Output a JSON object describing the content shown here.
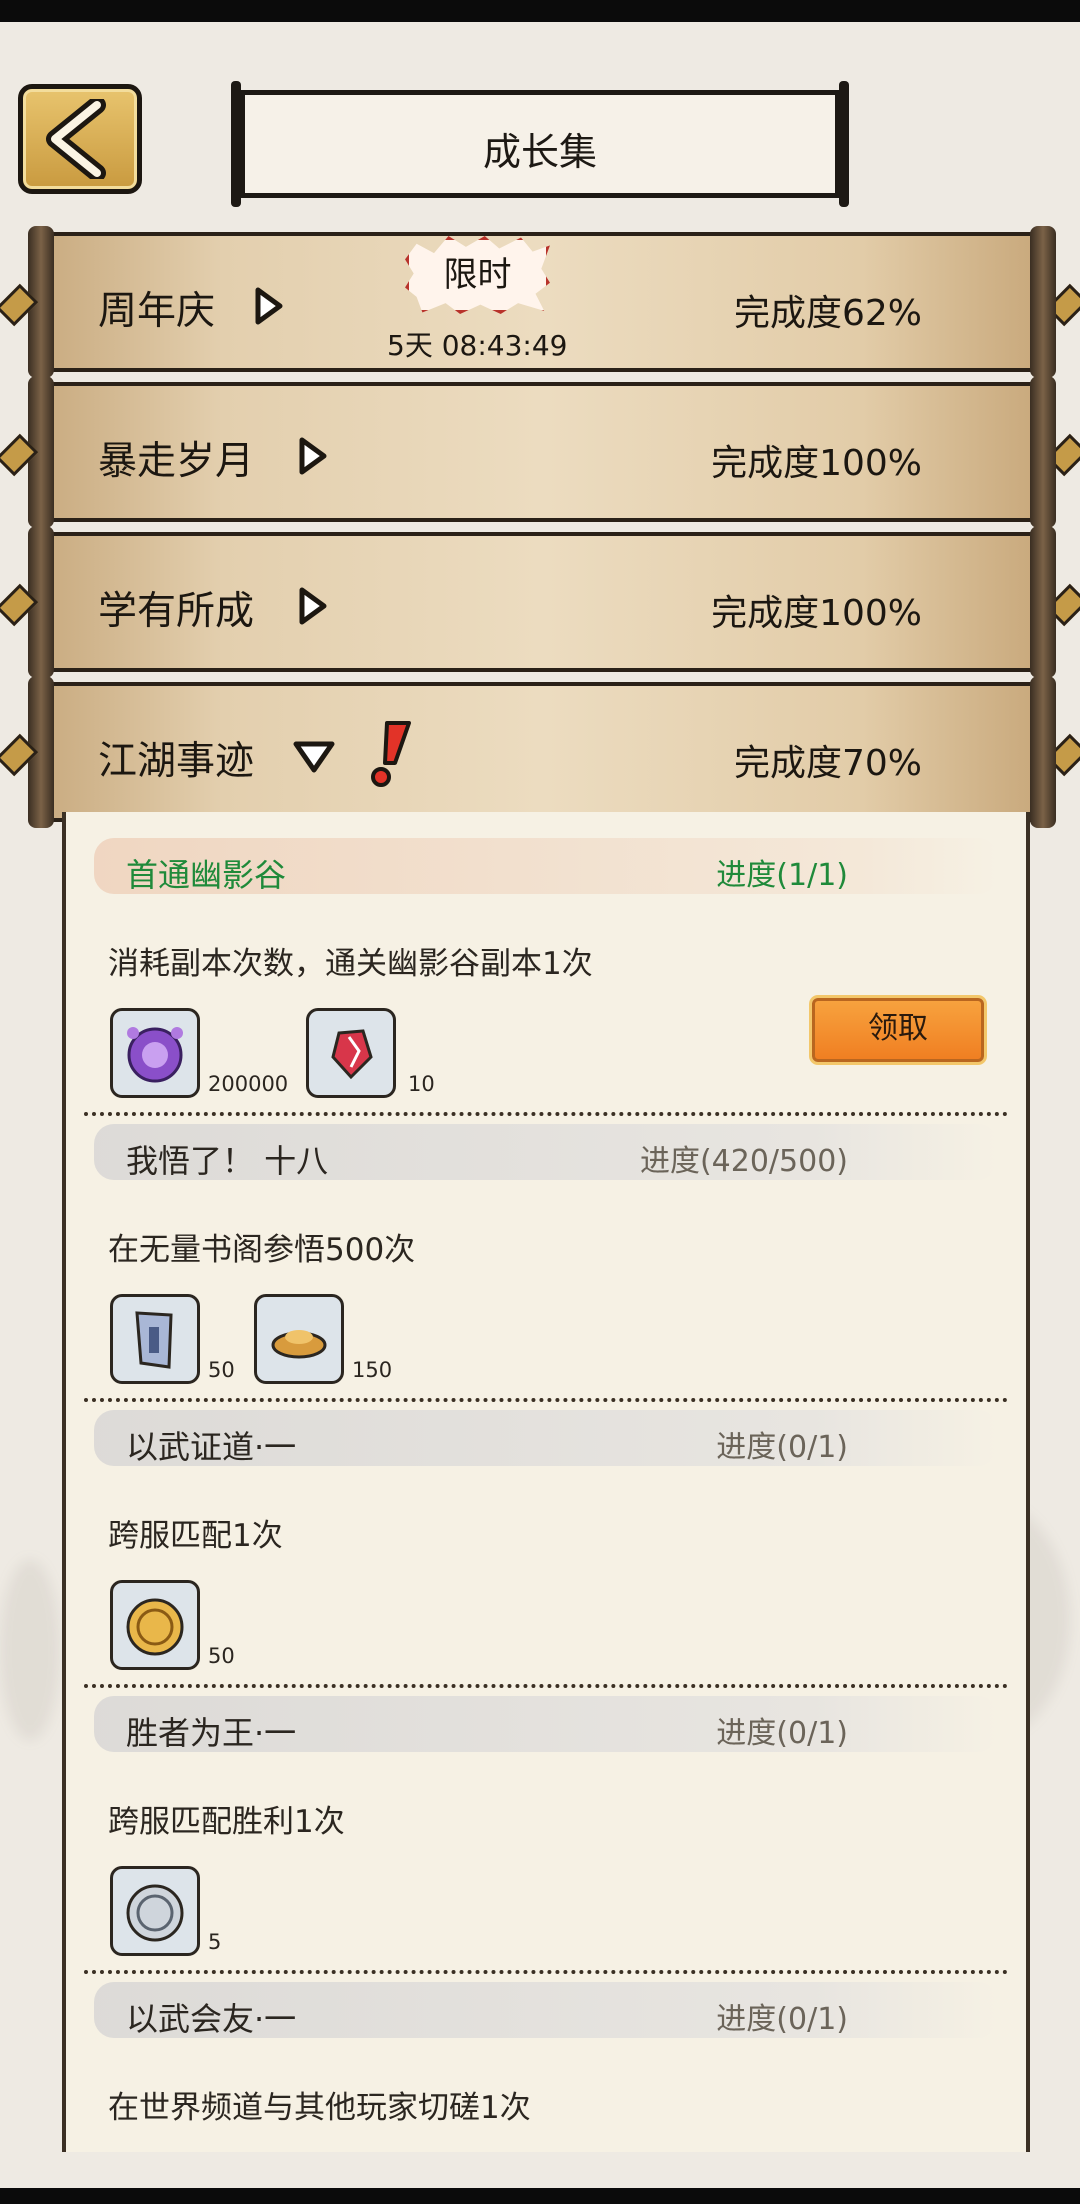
{
  "header": {
    "title": "成长集"
  },
  "categories": [
    {
      "name": "周年庆",
      "progress": "完成度62%",
      "badge": "限时",
      "countdown": "5天 08:43:49"
    },
    {
      "name": "暴走岁月",
      "progress": "完成度100%"
    },
    {
      "name": "学有所成",
      "progress": "完成度100%"
    },
    {
      "name": "江湖事迹",
      "progress": "完成度70%"
    }
  ],
  "tasks": [
    {
      "title": "首通幽影谷",
      "progress": "进度(1/1)",
      "desc": "消耗副本次数，通关幽影谷副本1次",
      "rewards": [
        {
          "icon": "purple-token-icon",
          "count": "200000"
        },
        {
          "icon": "red-crystal-icon",
          "count": "10"
        }
      ],
      "claim_label": "领取"
    },
    {
      "title": "我悟了！ 十八",
      "progress": "进度(420/500)",
      "desc": "在无量书阁参悟500次",
      "rewards": [
        {
          "icon": "scroll-ticket-icon",
          "count": "50"
        },
        {
          "icon": "gold-ingot-icon",
          "count": "150"
        }
      ]
    },
    {
      "title": "以武证道·一",
      "progress": "进度(0/1)",
      "desc": "跨服匹配1次",
      "rewards": [
        {
          "icon": "gold-coin-icon",
          "count": "50"
        }
      ]
    },
    {
      "title": "胜者为王·一",
      "progress": "进度(0/1)",
      "desc": "跨服匹配胜利1次",
      "rewards": [
        {
          "icon": "silver-coin-icon",
          "count": "5"
        }
      ]
    },
    {
      "title": "以武会友·一",
      "progress": "进度(0/1)",
      "desc": "在世界频道与其他玩家切磋1次",
      "rewards": []
    }
  ]
}
